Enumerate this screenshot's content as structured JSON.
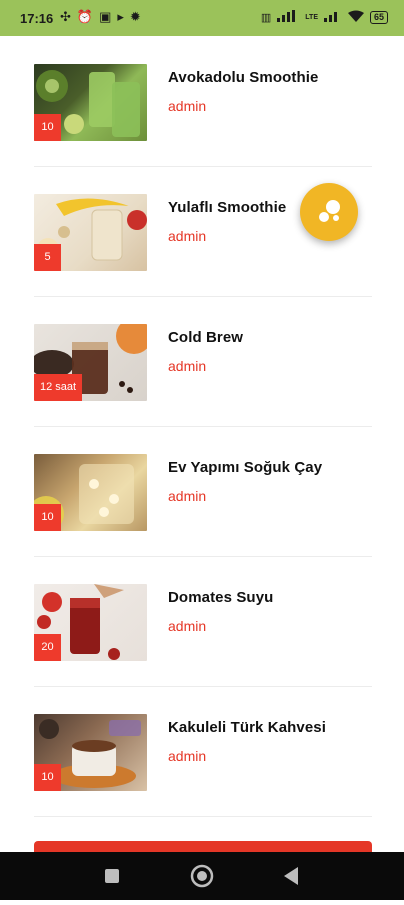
{
  "status_bar": {
    "time": "17:16",
    "left_icons": [
      "fan-icon",
      "alarm-icon",
      "sim-card-icon",
      "play-icon",
      "settings-icon"
    ],
    "battery": "65",
    "network_label": "LTE"
  },
  "recipes": [
    {
      "title": "Avokadolu Smoothie",
      "author": "admin",
      "badge": "10",
      "image": "avocado-smoothie-image"
    },
    {
      "title": "Yulaflı Smoothie",
      "author": "admin",
      "badge": "5",
      "image": "oat-smoothie-image"
    },
    {
      "title": "Cold Brew",
      "author": "admin",
      "badge": "12 saat",
      "image": "cold-brew-image"
    },
    {
      "title": "Ev Yapımı Soğuk Çay",
      "author": "admin",
      "badge": "10",
      "image": "iced-tea-image"
    },
    {
      "title": "Domates Suyu",
      "author": "admin",
      "badge": "20",
      "image": "tomato-juice-image"
    },
    {
      "title": "Kakuleli Türk Kahvesi",
      "author": "admin",
      "badge": "10",
      "image": "turkish-coffee-image"
    }
  ],
  "colors": {
    "status_bar_bg": "#9bc25a",
    "accent_red": "#e53727",
    "badge_red": "#ee3a2c",
    "fab_yellow": "#f1b625",
    "nav_bar_bg": "#0a0a0a"
  },
  "nav_bar": {
    "icons": [
      "recent-apps-icon",
      "home-icon",
      "back-icon"
    ]
  }
}
